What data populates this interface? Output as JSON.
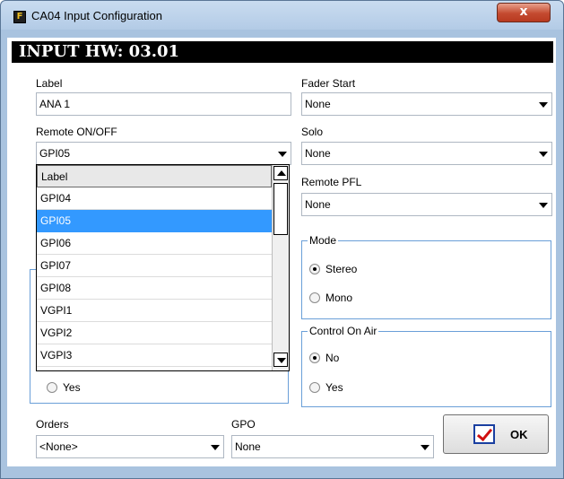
{
  "window": {
    "title": "CA04 Input Configuration",
    "app_icon_letter": "F",
    "close_label": "x"
  },
  "header": {
    "text": "INPUT HW: 03.01"
  },
  "left": {
    "label_caption": "Label",
    "label_value": "ANA 1",
    "remote_caption": "Remote ON/OFF",
    "remote_value": "GPI05",
    "dropdown": {
      "header": "Label",
      "items": [
        "GPI04",
        "GPI05",
        "GPI06",
        "GPI07",
        "GPI08",
        "VGPI1",
        "VGPI2",
        "VGPI3"
      ],
      "selected": "GPI05"
    },
    "hidden_group_yes": "Yes"
  },
  "right": {
    "fader_caption": "Fader Start",
    "fader_value": "None",
    "solo_caption": "Solo",
    "solo_value": "None",
    "pfl_caption": "Remote PFL",
    "pfl_value": "None",
    "mode": {
      "title": "Mode",
      "options": [
        "Stereo",
        "Mono"
      ],
      "selected": "Stereo"
    },
    "onair": {
      "title": "Control On Air",
      "options": [
        "No",
        "Yes"
      ],
      "selected": "No"
    }
  },
  "bottom": {
    "orders_caption": "Orders",
    "orders_value": "<None>",
    "gpo_caption": "GPO",
    "gpo_value": "None",
    "ok_label": "OK"
  },
  "colors": {
    "selection": "#3399ff",
    "group_border": "#6a9fd8",
    "frame": "#a9c3df"
  }
}
